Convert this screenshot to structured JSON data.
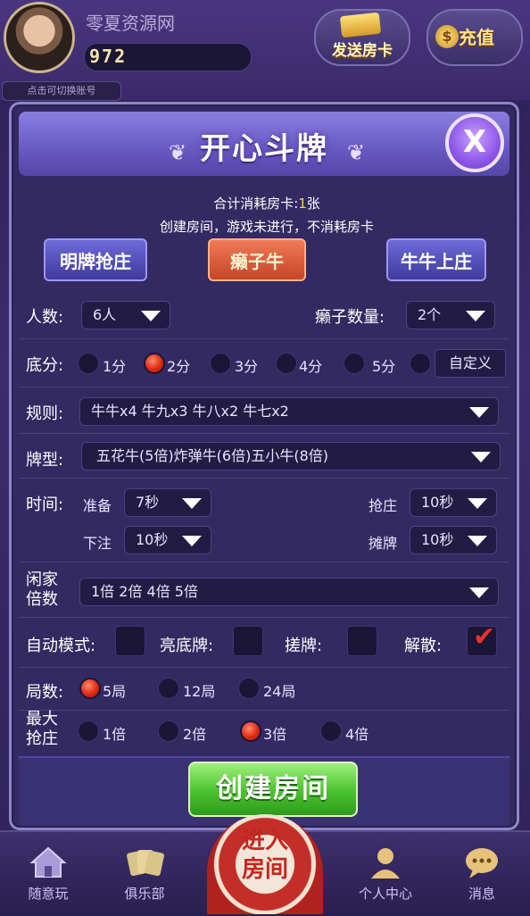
{
  "header": {
    "username": "零夏资源网",
    "score": "972",
    "switch_tip": "点击可切换账号",
    "send_card_label": "发送房卡",
    "recharge_label": "充值"
  },
  "modal": {
    "title": "开心斗牌",
    "close_label": "X",
    "cost_prefix": "合计消耗房卡:",
    "cost_value": "1",
    "cost_unit": "张",
    "cost_note": "创建房间，游戏未进行，不消耗房卡",
    "modes": [
      "明牌抢庄",
      "癞子牛",
      "牛牛上庄"
    ],
    "selected_mode": "癞子牛",
    "players_label": "人数:",
    "players_value": "6人",
    "laizi_label": "癞子数量:",
    "laizi_value": "2个",
    "base_label": "底分:",
    "base_options": [
      "1分",
      "2分",
      "3分",
      "4分",
      "5分"
    ],
    "base_selected": "2分",
    "base_custom": "自定义",
    "rule_label": "规则:",
    "rule_value": "牛牛x4 牛九x3 牛八x2 牛七x2",
    "cardtype_label": "牌型:",
    "cardtype_value": "五花牛(5倍)炸弹牛(6倍)五小牛(8倍)",
    "time_label": "时间:",
    "ready_label": "准备",
    "ready_value": "7秒",
    "grab_label": "抢庄",
    "grab_value": "10秒",
    "bet_label": "下注",
    "bet_value": "10秒",
    "show_label": "摊牌",
    "show_value": "10秒",
    "idle_label_1": "闲家",
    "idle_label_2": "倍数",
    "idle_value": "1倍 2倍 4倍 5倍",
    "auto_label": "自动模式:",
    "bright_label": "亮底牌:",
    "rub_label": "搓牌:",
    "dissolve_label": "解散:",
    "rounds_label": "局数:",
    "rounds_options": [
      "5局",
      "12局",
      "24局"
    ],
    "rounds_selected": "5局",
    "maxgrab_label_1": "最大",
    "maxgrab_label_2": "抢庄",
    "maxgrab_options": [
      "1倍",
      "2倍",
      "3倍",
      "4倍"
    ],
    "maxgrab_selected": "3倍",
    "create_label": "创建房间"
  },
  "bottom_nav": {
    "items": [
      "随意玩",
      "俱乐部",
      "个人中心",
      "消息"
    ],
    "enter_room_1": "进入",
    "enter_room_2": "房间"
  },
  "colors": {
    "accent_yellow": "#ffd34d",
    "radio_on": "#e02a10",
    "create_green": "#4fc632",
    "mode_selected": "#c6452a"
  }
}
